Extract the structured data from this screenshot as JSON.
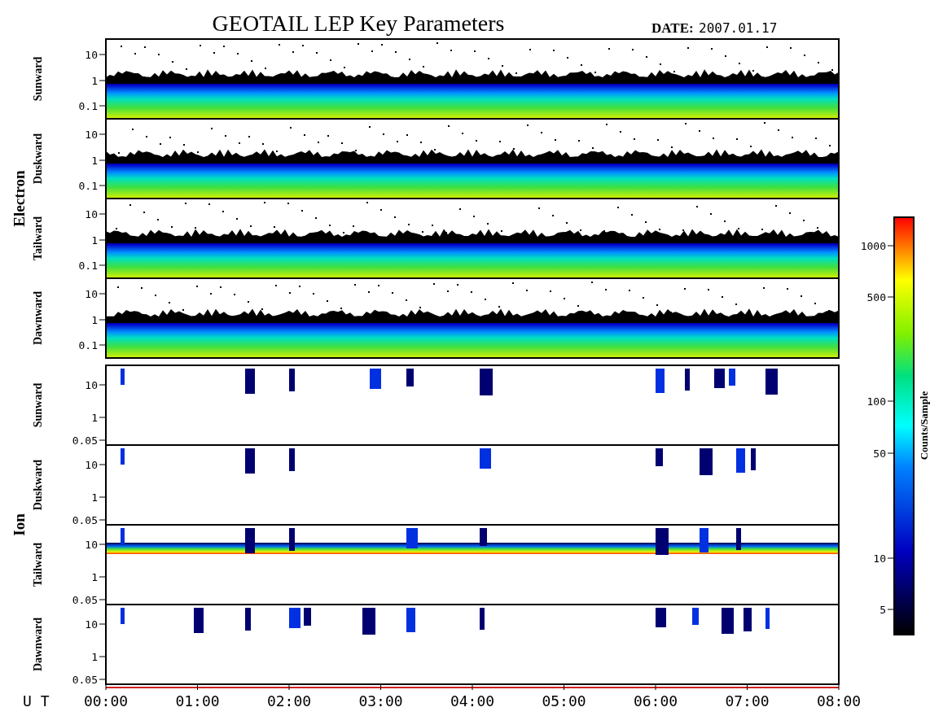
{
  "title": "GEOTAIL LEP Key Parameters",
  "date_label": "DATE:",
  "date": "2007.01.17",
  "groups": [
    {
      "label": "Electron",
      "kind": "electron",
      "panels": [
        {
          "label": "Sunward",
          "ticks": [
            "10",
            "1",
            "0.1"
          ]
        },
        {
          "label": "Duskward",
          "ticks": [
            "10",
            "1",
            "0.1"
          ]
        },
        {
          "label": "Tailward",
          "ticks": [
            "10",
            "1",
            "0.1"
          ]
        },
        {
          "label": "Dawnward",
          "ticks": [
            "10",
            "1",
            "0.1"
          ]
        }
      ]
    },
    {
      "label": "Ion",
      "kind": "ion",
      "panels": [
        {
          "label": "Sunward",
          "ticks": [
            "10",
            "1",
            "0.05"
          ]
        },
        {
          "label": "Duskward",
          "ticks": [
            "10",
            "1",
            "0.05"
          ]
        },
        {
          "label": "Tailward",
          "ticks": [
            "10",
            "1",
            "0.05"
          ]
        },
        {
          "label": "Dawnward",
          "ticks": [
            "10",
            "1",
            "0.05"
          ]
        }
      ]
    }
  ],
  "colorbar": {
    "title": "Counts/Sample",
    "ticks": [
      "1000",
      "500",
      "100",
      "50",
      "10",
      "5"
    ]
  },
  "time_axis": {
    "label": "U T",
    "ticks": [
      "00:00",
      "01:00",
      "02:00",
      "03:00",
      "04:00",
      "05:00",
      "06:00",
      "07:00",
      "08:00"
    ]
  }
}
